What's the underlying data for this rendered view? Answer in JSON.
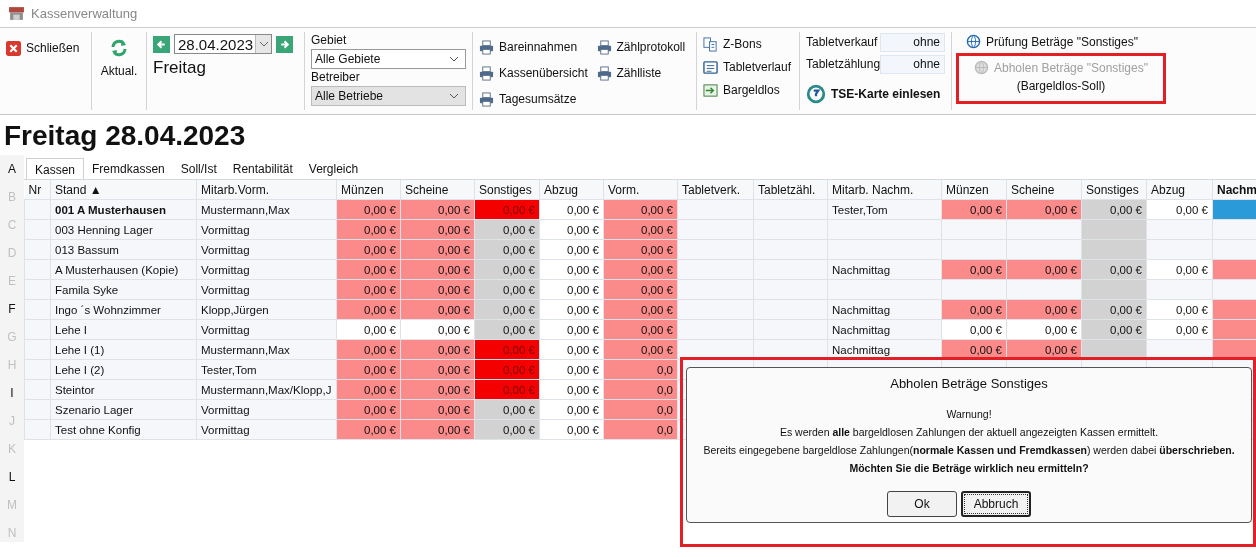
{
  "window": {
    "title": "Kassenverwaltung"
  },
  "toolbar": {
    "close": {
      "label": "Schließen"
    },
    "refresh": {
      "label": "Aktual."
    },
    "date": {
      "value": "28.04.2023",
      "weekday": "Freitag"
    },
    "filters": [
      {
        "label": "Gebiet",
        "value": "Alle Gebiete",
        "disabled": false
      },
      {
        "label": "Betreiber",
        "value": "Alle Betriebe",
        "disabled": true
      }
    ],
    "reports": [
      "Bareinnahmen",
      "Zählprotokoll",
      "Kassenübersicht",
      "Zählliste",
      "Tagesumsätze"
    ],
    "documents": [
      {
        "label": "Z-Bons",
        "kind": "receipts"
      },
      {
        "label": "Tabletverlauf",
        "kind": "tablet"
      },
      {
        "label": "Bargeldlos",
        "kind": "cashless"
      }
    ],
    "tablet_fields": [
      {
        "label": "Tabletverkauf",
        "value": "ohne"
      },
      {
        "label": "Tabletzählung",
        "value": "ohne"
      }
    ],
    "tse": {
      "label": "TSE-Karte einlesen"
    },
    "checks": [
      {
        "label": "Prüfung Beträge \"Sonstiges\"",
        "disabled": false
      },
      {
        "label": "Abholen Beträge \"Sonstiges\"",
        "sublabel": "(Bargeldlos-Soll)",
        "disabled": true
      }
    ]
  },
  "heading": "Freitag 28.04.2023",
  "letters": [
    {
      "text": "A",
      "active": true
    },
    {
      "text": "B",
      "active": false
    },
    {
      "text": "C",
      "active": false
    },
    {
      "text": "D",
      "active": false
    },
    {
      "text": "E",
      "active": false
    },
    {
      "text": "F",
      "active": true
    },
    {
      "text": "G",
      "active": false
    },
    {
      "text": "H",
      "active": false
    },
    {
      "text": "I",
      "active": true
    },
    {
      "text": "J",
      "active": false
    },
    {
      "text": "K",
      "active": false
    },
    {
      "text": "L",
      "active": true
    },
    {
      "text": "M",
      "active": false
    },
    {
      "text": "N",
      "active": false
    }
  ],
  "tabs": [
    {
      "label": "Kassen",
      "selected": true
    },
    {
      "label": "Fremdkassen",
      "selected": false
    },
    {
      "label": "Soll/Ist",
      "selected": false
    },
    {
      "label": "Rentabilität",
      "selected": false
    },
    {
      "label": "Vergleich",
      "selected": false
    }
  ],
  "table": {
    "columns": [
      "Nr",
      "Stand ▲",
      "Mitarb.Vorm.",
      "Münzen",
      "Scheine",
      "Sonstiges",
      "Abzug",
      "Vorm.",
      "Tabletverk.",
      "Tabletzähl.",
      "Mitarb. Nachm.",
      "Münzen",
      "Scheine",
      "Sonstiges",
      "Abzug",
      "Nachm"
    ],
    "rows": [
      {
        "stand": "001 A Musterhausen",
        "selected": true,
        "staff_am": "Mustermann,Max",
        "am": [
          {
            "text": "0,00 €",
            "color": "#fb8a8a"
          },
          {
            "text": "0,00 €",
            "color": "#fb8a8a"
          },
          {
            "text": "0,00 €",
            "color": "#f50000"
          },
          {
            "text": "0,00 €",
            "color": "#ffffff"
          },
          {
            "text": "0,00 €",
            "color": "#fb8a8a"
          }
        ],
        "staff_pm": "Tester,Tom",
        "pm": [
          {
            "text": "0,00 €",
            "color": "#fb8a8a"
          },
          {
            "text": "0,00 €",
            "color": "#fb8a8a"
          },
          {
            "text": "0,00 €",
            "color": "#d2d2d2"
          },
          {
            "text": "0,00 €",
            "color": "#ffffff"
          },
          {
            "color": "#2a9ad8"
          }
        ]
      },
      {
        "stand": "003 Henning Lager",
        "selected": false,
        "staff_am": "Vormittag",
        "am": [
          {
            "text": "0,00 €",
            "color": "#fb8a8a"
          },
          {
            "text": "0,00 €",
            "color": "#fb8a8a"
          },
          {
            "text": "0,00 €",
            "color": "#d2d2d2"
          },
          {
            "text": "0,00 €",
            "color": "#ffffff"
          },
          {
            "text": "0,00 €",
            "color": "#fb8a8a"
          }
        ],
        "pm": [
          {
            "color": "#f5f7fa"
          },
          {
            "color": "#f5f7fa"
          },
          {
            "color": "#d2d2d2"
          },
          {
            "color": "#f5f7fa"
          },
          {
            "color": "#f5f7fa"
          }
        ]
      },
      {
        "stand": "013 Bassum",
        "selected": false,
        "staff_am": "Vormittag",
        "am": [
          {
            "text": "0,00 €",
            "color": "#fb8a8a"
          },
          {
            "text": "0,00 €",
            "color": "#fb8a8a"
          },
          {
            "text": "0,00 €",
            "color": "#d2d2d2"
          },
          {
            "text": "0,00 €",
            "color": "#ffffff"
          },
          {
            "text": "0,00 €",
            "color": "#fb8a8a"
          }
        ],
        "pm": [
          {
            "color": "#f5f7fa"
          },
          {
            "color": "#f5f7fa"
          },
          {
            "color": "#d2d2d2"
          },
          {
            "color": "#f5f7fa"
          },
          {
            "color": "#f5f7fa"
          }
        ]
      },
      {
        "stand": "A Musterhausen (Kopie)",
        "selected": false,
        "staff_am": "Vormittag",
        "am": [
          {
            "text": "0,00 €",
            "color": "#fb8a8a"
          },
          {
            "text": "0,00 €",
            "color": "#fb8a8a"
          },
          {
            "text": "0,00 €",
            "color": "#d2d2d2"
          },
          {
            "text": "0,00 €",
            "color": "#ffffff"
          },
          {
            "text": "0,00 €",
            "color": "#fb8a8a"
          }
        ],
        "staff_pm": "Nachmittag",
        "pm": [
          {
            "text": "0,00 €",
            "color": "#fb8a8a"
          },
          {
            "text": "0,00 €",
            "color": "#fb8a8a"
          },
          {
            "text": "0,00 €",
            "color": "#d2d2d2"
          },
          {
            "text": "0,00 €",
            "color": "#ffffff"
          },
          {
            "color": "#fb8a8a"
          }
        ]
      },
      {
        "stand": "Famila Syke",
        "selected": false,
        "staff_am": "Vormittag",
        "am": [
          {
            "text": "0,00 €",
            "color": "#fb8a8a"
          },
          {
            "text": "0,00 €",
            "color": "#fb8a8a"
          },
          {
            "text": "0,00 €",
            "color": "#d2d2d2"
          },
          {
            "text": "0,00 €",
            "color": "#ffffff"
          },
          {
            "text": "0,00 €",
            "color": "#fb8a8a"
          }
        ],
        "pm": [
          {
            "color": "#f5f7fa"
          },
          {
            "color": "#f5f7fa"
          },
          {
            "color": "#d2d2d2"
          },
          {
            "color": "#f5f7fa"
          },
          {
            "color": "#f5f7fa"
          }
        ]
      },
      {
        "stand": "Ingo ´s Wohnzimmer",
        "selected": false,
        "staff_am": "Klopp,Jürgen",
        "am": [
          {
            "text": "0,00 €",
            "color": "#fb8a8a"
          },
          {
            "text": "0,00 €",
            "color": "#fb8a8a"
          },
          {
            "text": "0,00 €",
            "color": "#d2d2d2"
          },
          {
            "text": "0,00 €",
            "color": "#ffffff"
          },
          {
            "text": "0,00 €",
            "color": "#fb8a8a"
          }
        ],
        "staff_pm": "Nachmittag",
        "pm": [
          {
            "text": "0,00 €",
            "color": "#fb8a8a"
          },
          {
            "text": "0,00 €",
            "color": "#fb8a8a"
          },
          {
            "text": "0,00 €",
            "color": "#d2d2d2"
          },
          {
            "text": "0,00 €",
            "color": "#ffffff"
          },
          {
            "color": "#fb8a8a"
          }
        ]
      },
      {
        "stand": "Lehe I",
        "selected": false,
        "staff_am": "Vormittag",
        "am": [
          {
            "text": "0,00 €",
            "color": "#ffffff"
          },
          {
            "text": "0,00 €",
            "color": "#ffffff"
          },
          {
            "text": "0,00 €",
            "color": "#d2d2d2"
          },
          {
            "text": "0,00 €",
            "color": "#ffffff"
          },
          {
            "text": "0,00 €",
            "color": "#fb8a8a"
          }
        ],
        "staff_pm": "Nachmittag",
        "pm": [
          {
            "text": "0,00 €",
            "color": "#ffffff"
          },
          {
            "text": "0,00 €",
            "color": "#ffffff"
          },
          {
            "text": "0,00 €",
            "color": "#d2d2d2"
          },
          {
            "text": "0,00 €",
            "color": "#ffffff"
          },
          {
            "color": "#fb8a8a"
          }
        ]
      },
      {
        "stand": "Lehe I (1)",
        "selected": false,
        "staff_am": "Mustermann,Max",
        "am": [
          {
            "text": "0,00 €",
            "color": "#fb8a8a"
          },
          {
            "text": "0,00 €",
            "color": "#fb8a8a"
          },
          {
            "text": "0,00 €",
            "color": "#f50000"
          },
          {
            "text": "0,00 €",
            "color": "#ffffff"
          },
          {
            "text": "0,00 €",
            "color": "#fb8a8a"
          }
        ],
        "staff_pm": "Nachmittag",
        "pm": [
          {
            "text": "0,00 €",
            "color": "#fb8a8a"
          },
          {
            "text": "0,00 €",
            "color": "#fb8a8a"
          },
          {
            "color": "#d2d2d2"
          },
          {
            "color": "#f5f7fa"
          },
          {
            "color": "#fb8a8a"
          }
        ]
      },
      {
        "stand": "Lehe I (2)",
        "selected": false,
        "staff_am": "Tester,Tom",
        "am": [
          {
            "text": "0,00 €",
            "color": "#fb8a8a"
          },
          {
            "text": "0,00 €",
            "color": "#fb8a8a"
          },
          {
            "text": "0,00 €",
            "color": "#f50000"
          },
          {
            "text": "0,00 €",
            "color": "#ffffff"
          },
          {
            "text": "0,0",
            "color": "#fb8a8a"
          }
        ],
        "pm": []
      },
      {
        "stand": "Steintor",
        "selected": false,
        "staff_am": "Mustermann,Max/Klopp,J",
        "am": [
          {
            "text": "0,00 €",
            "color": "#fb8a8a"
          },
          {
            "text": "0,00 €",
            "color": "#fb8a8a"
          },
          {
            "text": "0,00 €",
            "color": "#f50000"
          },
          {
            "text": "0,00 €",
            "color": "#ffffff"
          },
          {
            "text": "0,0",
            "color": "#fb8a8a"
          }
        ],
        "pm": []
      },
      {
        "stand": "Szenario Lager",
        "selected": false,
        "staff_am": "Vormittag",
        "am": [
          {
            "text": "0,00 €",
            "color": "#fb8a8a"
          },
          {
            "text": "0,00 €",
            "color": "#fb8a8a"
          },
          {
            "text": "0,00 €",
            "color": "#d2d2d2"
          },
          {
            "text": "0,00 €",
            "color": "#ffffff"
          },
          {
            "text": "0,0",
            "color": "#fb8a8a"
          }
        ],
        "pm": []
      },
      {
        "stand": "Test ohne Konfig",
        "selected": false,
        "staff_am": "Vormittag",
        "am": [
          {
            "text": "0,00 €",
            "color": "#fb8a8a"
          },
          {
            "text": "0,00 €",
            "color": "#fb8a8a"
          },
          {
            "text": "0,00 €",
            "color": "#d2d2d2"
          },
          {
            "text": "0,00 €",
            "color": "#ffffff"
          },
          {
            "text": "0,0",
            "color": "#fb8a8a"
          }
        ],
        "pm": []
      }
    ]
  },
  "dialog": {
    "title": "Abholen Beträge Sonstiges",
    "lines": [
      {
        "text": "Warnung!",
        "bold": false
      },
      {
        "text": "Es werden **alle** bargeldlosen Zahlungen der aktuell angezeigten Kassen ermittelt.",
        "bold": false
      },
      {
        "text": "Bereits eingegebene bargeldlose Zahlungen(**normale Kassen und Fremdkassen**) werden dabei **überschrieben.**",
        "bold": false
      },
      {
        "text": "Möchten Sie die Beträge wirklich neu ermitteln?",
        "bold": true
      }
    ],
    "buttons": [
      {
        "label": "Ok",
        "focused": false
      },
      {
        "label": "Abbruch",
        "focused": true
      }
    ]
  }
}
